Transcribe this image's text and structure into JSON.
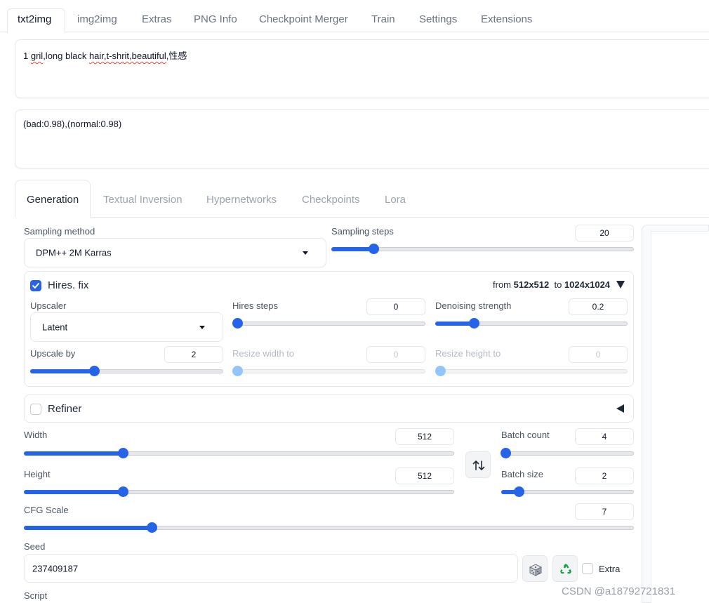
{
  "top_tabs": [
    "txt2img",
    "img2img",
    "Extras",
    "PNG Info",
    "Checkpoint Merger",
    "Train",
    "Settings",
    "Extensions"
  ],
  "prompt": {
    "p1": "1 ",
    "p2": "gril",
    "p3": ",long black ",
    "p4": "hair,t-shrit,beautiful",
    "p5": ",性感"
  },
  "negative_prompt": "(bad:0.98),(normal:0.98)",
  "gen_tabs": [
    "Generation",
    "Textual Inversion",
    "Hypernetworks",
    "Checkpoints",
    "Lora"
  ],
  "sampling": {
    "method_label": "Sampling method",
    "method_value": "DPM++ 2M Karras",
    "steps_label": "Sampling steps",
    "steps_value": "20",
    "steps_fraction": 0.14
  },
  "hires": {
    "label": "Hires. fix",
    "checked": true,
    "from_label": "from",
    "from_value": "512x512",
    "to_label": "to",
    "to_value": "1024x1024",
    "upscaler_label": "Upscaler",
    "upscaler_value": "Latent",
    "hires_steps_label": "Hires steps",
    "hires_steps_value": "0",
    "hires_steps_fraction": 0.0,
    "denoise_label": "Denoising strength",
    "denoise_value": "0.2",
    "denoise_fraction": 0.2,
    "upscale_by_label": "Upscale by",
    "upscale_by_value": "2",
    "upscale_by_fraction": 0.33,
    "resize_w_label": "Resize width to",
    "resize_w_value": "0",
    "resize_h_label": "Resize height to",
    "resize_h_value": "0"
  },
  "refiner": {
    "label": "Refiner",
    "checked": false
  },
  "size": {
    "width_label": "Width",
    "width_value": "512",
    "width_fraction": 0.23,
    "height_label": "Height",
    "height_value": "512",
    "height_fraction": 0.23
  },
  "batch": {
    "count_label": "Batch count",
    "count_value": "4",
    "count_fraction": 0.03,
    "size_label": "Batch size",
    "size_value": "2",
    "size_fraction": 0.13
  },
  "cfg": {
    "label": "CFG Scale",
    "value": "7",
    "fraction": 0.21
  },
  "seed": {
    "label": "Seed",
    "value": "237409187",
    "extra_label": "Extra"
  },
  "script_label": "Script",
  "watermark": "CSDN @a18792721831",
  "colors": {
    "accent": "#2563eb",
    "accent_dim": "#93c5fd",
    "border": "#e5e7eb",
    "recycle": "#16a34a"
  },
  "icons": [
    "dice-icon",
    "recycle-icon",
    "swap-icon",
    "caret-down-icon",
    "triangle-down-icon",
    "triangle-left-icon",
    "check-icon"
  ]
}
